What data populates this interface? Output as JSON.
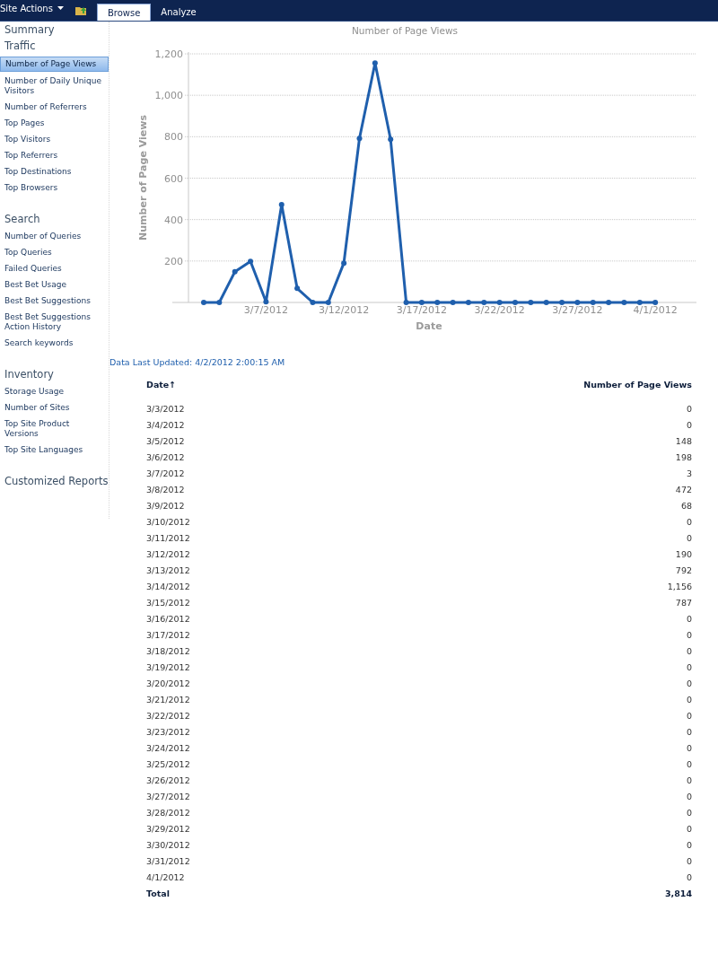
{
  "ribbon": {
    "site_actions": "Site Actions",
    "tabs": [
      {
        "label": "Browse",
        "selected": true
      },
      {
        "label": "Analyze",
        "selected": false
      }
    ]
  },
  "sidebar": {
    "sections": [
      {
        "heading": "Summary"
      },
      {
        "heading": "Traffic",
        "items": [
          {
            "label": "Number of Page Views",
            "selected": true
          },
          {
            "label": "Number of Daily Unique Visitors",
            "selected": false
          },
          {
            "label": "Number of Referrers",
            "selected": false
          },
          {
            "label": "Top Pages",
            "selected": false
          },
          {
            "label": "Top Visitors",
            "selected": false
          },
          {
            "label": "Top Referrers",
            "selected": false
          },
          {
            "label": "Top Destinations",
            "selected": false
          },
          {
            "label": "Top Browsers",
            "selected": false
          }
        ]
      },
      {
        "heading": "Search",
        "items": [
          {
            "label": "Number of Queries",
            "selected": false
          },
          {
            "label": "Top Queries",
            "selected": false
          },
          {
            "label": "Failed Queries",
            "selected": false
          },
          {
            "label": "Best Bet Usage",
            "selected": false
          },
          {
            "label": "Best Bet Suggestions",
            "selected": false
          },
          {
            "label": "Best Bet Suggestions Action History",
            "selected": false
          },
          {
            "label": "Search keywords",
            "selected": false
          }
        ]
      },
      {
        "heading": "Inventory",
        "items": [
          {
            "label": "Storage Usage",
            "selected": false
          },
          {
            "label": "Number of Sites",
            "selected": false
          },
          {
            "label": "Top Site Product Versions",
            "selected": false
          },
          {
            "label": "Top Site Languages",
            "selected": false
          }
        ]
      },
      {
        "heading": "Customized Reports"
      }
    ]
  },
  "chart": {
    "chart_data": {
      "type": "line",
      "title": "Number of Page Views",
      "xlabel": "Date",
      "ylabel": "Number of Page Views",
      "categories": [
        null,
        null,
        null,
        null,
        "3/7/2012",
        null,
        null,
        null,
        null,
        "3/12/2012",
        null,
        null,
        null,
        null,
        "3/17/2012",
        null,
        null,
        null,
        null,
        "3/22/2012",
        null,
        null,
        null,
        null,
        "3/27/2012",
        null,
        null,
        null,
        null,
        "4/1/2012"
      ],
      "grid": true,
      "series": [
        {
          "color": "#1f5fad",
          "marker": "circle",
          "values": [
            0,
            0,
            148,
            198,
            3,
            472,
            68,
            0,
            0,
            190,
            792,
            1156,
            787,
            0,
            0,
            0,
            0,
            0,
            0,
            0,
            0,
            0,
            0,
            0,
            0,
            0,
            0,
            0,
            0,
            0
          ]
        }
      ],
      "ylim": [
        0,
        1200
      ],
      "yticks": [
        {
          "value": 200,
          "label": "200"
        },
        {
          "value": 400,
          "label": "400"
        },
        {
          "value": 600,
          "label": "600"
        },
        {
          "value": 800,
          "label": "800"
        },
        {
          "value": 1000,
          "label": "1,000"
        },
        {
          "value": 1200,
          "label": "1,200"
        }
      ]
    }
  },
  "last_updated": "Data Last Updated: 4/2/2012 2:00:15 AM",
  "table": {
    "columns": [
      "Date↑",
      "Number of Page Views"
    ],
    "rows": [
      [
        "3/3/2012",
        "0"
      ],
      [
        "3/4/2012",
        "0"
      ],
      [
        "3/5/2012",
        "148"
      ],
      [
        "3/6/2012",
        "198"
      ],
      [
        "3/7/2012",
        "3"
      ],
      [
        "3/8/2012",
        "472"
      ],
      [
        "3/9/2012",
        "68"
      ],
      [
        "3/10/2012",
        "0"
      ],
      [
        "3/11/2012",
        "0"
      ],
      [
        "3/12/2012",
        "190"
      ],
      [
        "3/13/2012",
        "792"
      ],
      [
        "3/14/2012",
        "1,156"
      ],
      [
        "3/15/2012",
        "787"
      ],
      [
        "3/16/2012",
        "0"
      ],
      [
        "3/17/2012",
        "0"
      ],
      [
        "3/18/2012",
        "0"
      ],
      [
        "3/19/2012",
        "0"
      ],
      [
        "3/20/2012",
        "0"
      ],
      [
        "3/21/2012",
        "0"
      ],
      [
        "3/22/2012",
        "0"
      ],
      [
        "3/23/2012",
        "0"
      ],
      [
        "3/24/2012",
        "0"
      ],
      [
        "3/25/2012",
        "0"
      ],
      [
        "3/26/2012",
        "0"
      ],
      [
        "3/27/2012",
        "0"
      ],
      [
        "3/28/2012",
        "0"
      ],
      [
        "3/29/2012",
        "0"
      ],
      [
        "3/30/2012",
        "0"
      ],
      [
        "3/31/2012",
        "0"
      ],
      [
        "4/1/2012",
        "0"
      ]
    ],
    "total": [
      "Total",
      "3,814"
    ]
  }
}
